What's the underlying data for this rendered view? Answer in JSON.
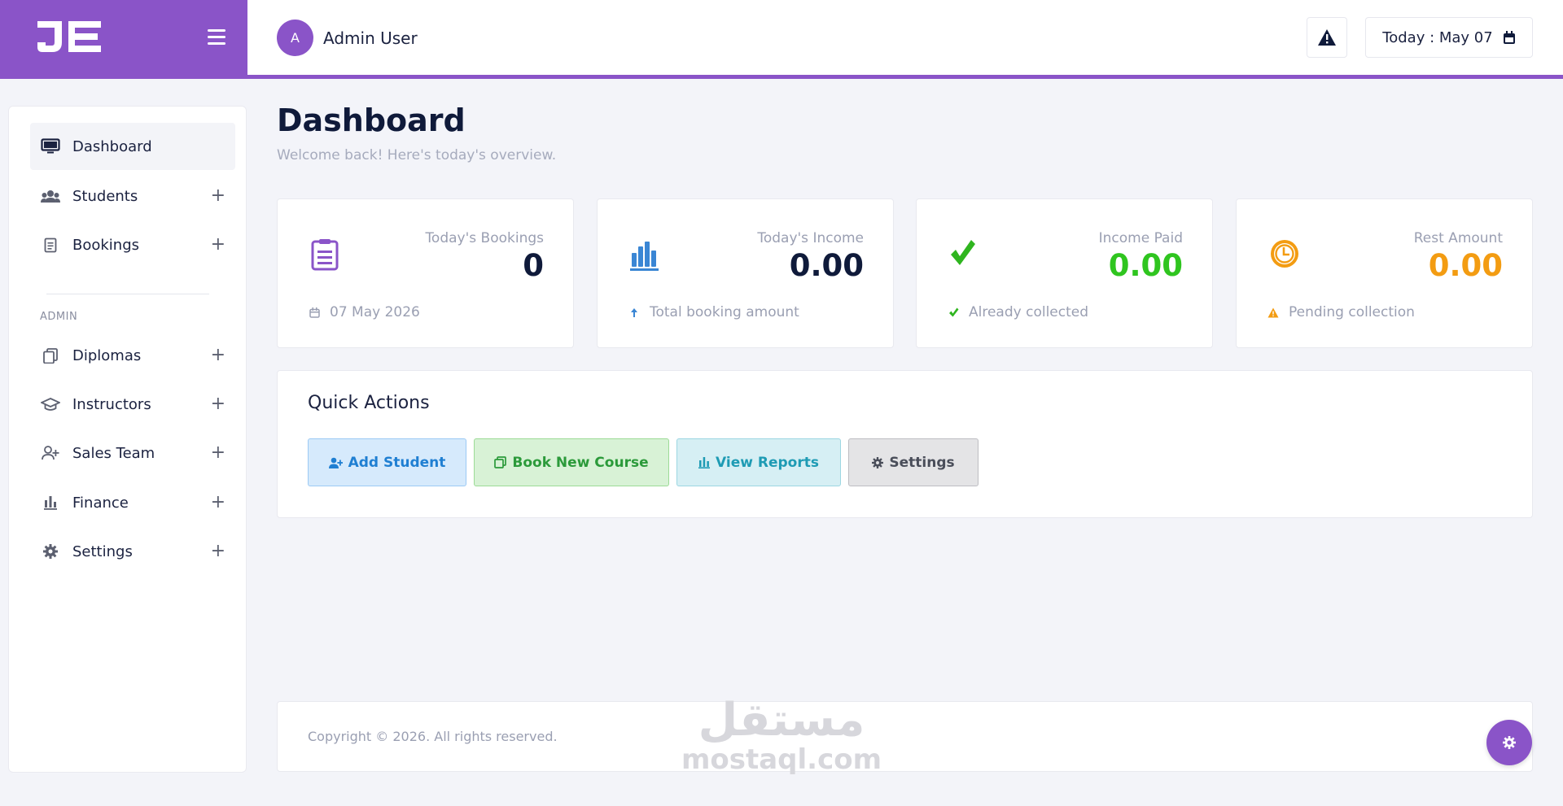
{
  "header": {
    "user_initial": "A",
    "user_name": "Admin User",
    "date_label": "Today : May 07",
    "brand_color": "#8a54c8"
  },
  "sidebar": {
    "items": [
      {
        "label": "Dashboard",
        "icon": "monitor-icon",
        "expandable": false,
        "active": true
      },
      {
        "label": "Students",
        "icon": "users-icon",
        "expandable": true
      },
      {
        "label": "Bookings",
        "icon": "clipboard-icon",
        "expandable": true
      }
    ],
    "section_label": "ADMIN",
    "admin_items": [
      {
        "label": "Diplomas",
        "icon": "copy-icon",
        "expandable": true
      },
      {
        "label": "Instructors",
        "icon": "graduation-cap-icon",
        "expandable": true
      },
      {
        "label": "Sales Team",
        "icon": "user-plus-icon",
        "expandable": true
      },
      {
        "label": "Finance",
        "icon": "bar-chart-icon",
        "expandable": true
      },
      {
        "label": "Settings",
        "icon": "gear-icon",
        "expandable": true
      }
    ]
  },
  "page": {
    "title": "Dashboard",
    "subtitle": "Welcome back! Here's today's overview."
  },
  "stats": [
    {
      "label": "Today's Bookings",
      "value": "0",
      "foot": "07 May 2026",
      "icon": "clipboard-icon",
      "foot_icon": "calendar-icon",
      "color": "#0f1a3a",
      "icon_color": "#8a54c8"
    },
    {
      "label": "Today's Income",
      "value": "0.00",
      "foot": "Total booking amount",
      "icon": "bar-chart-icon",
      "foot_icon": "arrow-up-icon",
      "color": "#0f1a3a",
      "icon_color": "#3a86d4"
    },
    {
      "label": "Income Paid",
      "value": "0.00",
      "foot": "Already collected",
      "icon": "check-icon",
      "foot_icon": "check-icon",
      "color": "#2fc51f",
      "icon_color": "#2fb51f"
    },
    {
      "label": "Rest Amount",
      "value": "0.00",
      "foot": "Pending collection",
      "icon": "clock-icon",
      "foot_icon": "warning-icon",
      "color": "#f39c12",
      "icon_color": "#f39c12"
    }
  ],
  "quick_actions": {
    "title": "Quick Actions",
    "buttons": [
      {
        "label": "Add Student",
        "icon": "user-plus-icon",
        "bg": "#d6eafc",
        "border": "#9ccaf4",
        "color": "#1f7fd2"
      },
      {
        "label": "Book New Course",
        "icon": "copy-icon",
        "bg": "#d8f2d6",
        "border": "#9cdb96",
        "color": "#2b9a3a"
      },
      {
        "label": "View Reports",
        "icon": "bar-chart-icon",
        "bg": "#d6eff4",
        "border": "#9cd6e2",
        "color": "#1e9bb4"
      },
      {
        "label": "Settings",
        "icon": "gear-icon",
        "bg": "#e4e4e6",
        "border": "#bdbdc2",
        "color": "#4a4e5a"
      }
    ]
  },
  "footer": {
    "copyright": "Copyright © 2026. All rights reserved."
  },
  "watermark": {
    "arabic": "مستقل",
    "latin": "mostaql.com"
  }
}
